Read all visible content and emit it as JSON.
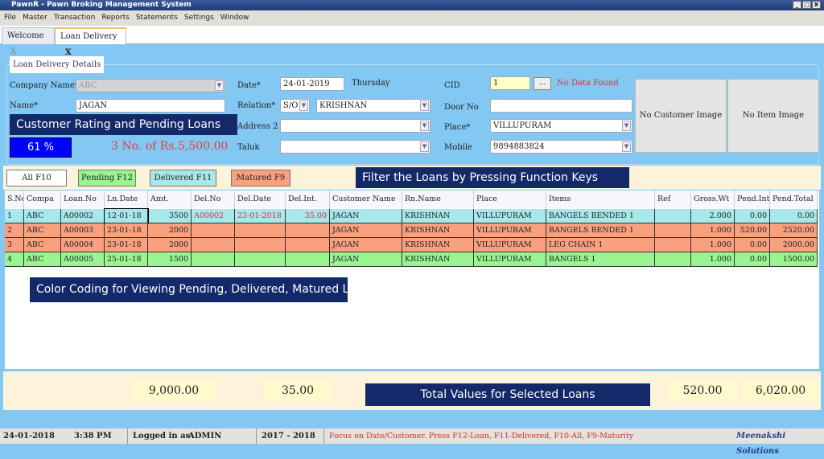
{
  "window": {
    "title": "PawnR - Pawn Broking Management System",
    "controls": [
      "_",
      "□",
      "X"
    ]
  },
  "menu": [
    "File",
    "Master",
    "Transaction",
    "Reports",
    "Statements",
    "Settings",
    "Window"
  ],
  "tabs": [
    {
      "label": "Welcome",
      "close": "X"
    },
    {
      "label": "Loan Delivery",
      "close": "X"
    }
  ],
  "form": {
    "section_title": "Loan Delivery Details",
    "company_label": "Company Name*",
    "company_value": "ABC",
    "name_label": "Name*",
    "name_value": "JAGAN",
    "date_label": "Date*",
    "date_value": "24-01-2019",
    "day": "Thursday",
    "relation_label": "Relation*",
    "relation_value": "S/O",
    "relation_name": "KRISHNAN",
    "address2_label": "Address 2",
    "address2_value": "",
    "taluk_label": "Taluk",
    "taluk_value": "",
    "cid_label": "CID",
    "cid_value": "1",
    "cid_button": "...",
    "cid_status": "No Data Found",
    "doorno_label": "Door No",
    "doorno_value": "",
    "place_label": "Place*",
    "place_value": "VILLUPURAM",
    "mobile_label": "Mobile",
    "mobile_value": "9894883824",
    "rating": "61 %",
    "rating_color": "#0000ff",
    "pending_loans": "3 No. of Rs.5,500.00",
    "customer_image": "No Customer Image",
    "item_image": "No Item Image"
  },
  "filters": [
    {
      "label": "All F10",
      "color": "#ffffff"
    },
    {
      "label": "Pending F12",
      "color": "#98f590"
    },
    {
      "label": "Delivered F11",
      "color": "#a8e8ec"
    },
    {
      "label": "Matured F9",
      "color": "#f9a07f"
    }
  ],
  "callouts": {
    "rating": "Customer Rating and Pending Loans",
    "filter": "Filter the Loans by Pressing Function Keys",
    "color": "Color Coding for Viewing Pending, Delivered, Matured Loans",
    "totals": "Total Values for Selected Loans"
  },
  "table": {
    "columns": [
      "S.No",
      "Compa",
      "Loan.No",
      "Ln.Date",
      "Amt.",
      "Del.No",
      "Del.Date",
      "Del.Int.",
      "Customer Name",
      "Rn.Name",
      "Place",
      "Items",
      "Ref",
      "Gross.Wt",
      "Pend.Int.",
      "Pend.Total"
    ],
    "rows": [
      {
        "color": "#a8e8ec",
        "cells": [
          "1",
          "ABC",
          "A00002",
          "12-01-18",
          "3500",
          "A00002",
          "23-01-2018",
          "35.00",
          "JAGAN",
          "KRISHNAN",
          "VILLUPURAM",
          "BANGELS BENDED 1",
          "",
          "2.000",
          "0.00",
          "0.00"
        ]
      },
      {
        "color": "#f9a07f",
        "cells": [
          "2",
          "ABC",
          "A00003",
          "23-01-18",
          "2000",
          "",
          "",
          "",
          "JAGAN",
          "KRISHNAN",
          "VILLUPURAM",
          "BANGELS BENDED 1",
          "",
          "1.000",
          "520.00",
          "2520.00"
        ]
      },
      {
        "color": "#f9a07f",
        "cells": [
          "3",
          "ABC",
          "A00004",
          "23-01-18",
          "2000",
          "",
          "",
          "",
          "JAGAN",
          "KRISHNAN",
          "VILLUPURAM",
          "LEG CHAIN  1",
          "",
          "1.000",
          "0.00",
          "2000.00"
        ]
      },
      {
        "color": "#98f590",
        "cells": [
          "4",
          "ABC",
          "A00005",
          "25-01-18",
          "1500",
          "",
          "",
          "",
          "JAGAN",
          "KRISHNAN",
          "VILLUPURAM",
          "BANGELS  1",
          "",
          "1.000",
          "0.00",
          "1500.00"
        ]
      }
    ]
  },
  "totals": {
    "amount": "9,000.00",
    "del_int": "35.00",
    "pend_int": "520.00",
    "pend_total": "6,020.00"
  },
  "status": {
    "date": "24-01-2018",
    "time": "3:38 PM",
    "login_label": "Logged in as",
    "user": "ADMIN",
    "year": "2017 - 2018",
    "hint": "Focus on Date/Customer. Press F12-Loan, F11-Delivered, F10-All, F9-Maturity",
    "company": "Meenakshi Solutions"
  }
}
